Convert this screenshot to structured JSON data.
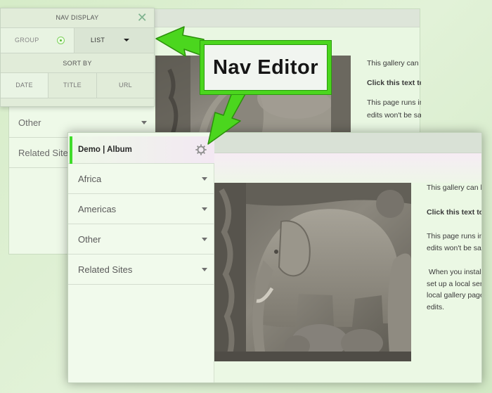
{
  "back_window": {
    "sidebar_items": [
      "Other",
      "Related Sites"
    ],
    "text_lines": [
      "This gallery can b",
      "Click this text to",
      "This page runs in",
      "edits won't be sav"
    ]
  },
  "nav_panel": {
    "title": "NAV DISPLAY",
    "close_glyph": "✕",
    "group_label": "GROUP",
    "display_mode": "LIST",
    "sort_label": "SORT BY",
    "sort_options": [
      "DATE",
      "TITLE",
      "URL"
    ],
    "active_sort": "DATE"
  },
  "callout": {
    "label": "Nav Editor",
    "accent_color": "#4bd61e"
  },
  "front_window": {
    "album_title": "Demo | Album",
    "sidebar_items": [
      "Africa",
      "Americas",
      "Other",
      "Related Sites"
    ],
    "text_lines": [
      "This gallery can b",
      "",
      "Click this text to",
      "",
      "This page runs in",
      "edits won't be sav",
      "",
      " When you install",
      "set up a local serv",
      "local gallery page",
      "edits."
    ],
    "accent_color": "#3fdc2a"
  },
  "icons": {
    "close": "close-icon",
    "radio": "radio-selected-icon",
    "dropdown": "chevron-down-icon",
    "settings": "gear-icon"
  }
}
